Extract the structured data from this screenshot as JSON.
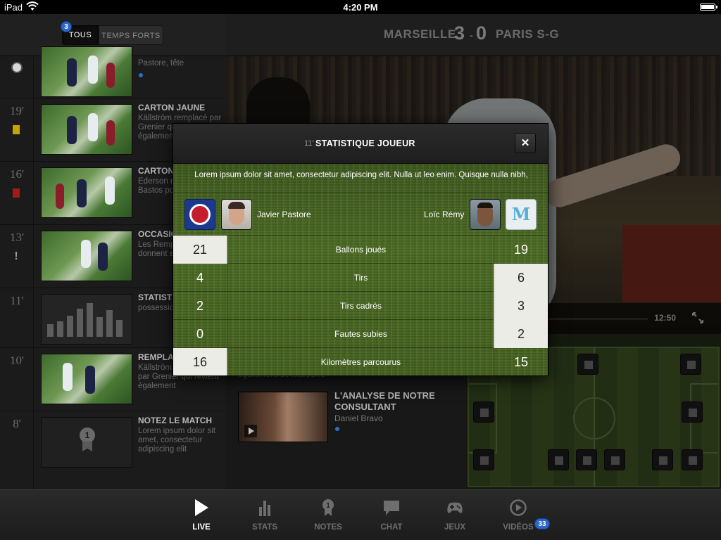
{
  "status_bar": {
    "device": "iPad",
    "time": "4:20 PM"
  },
  "filter": {
    "all_label": "TOUS",
    "highlights_label": "TEMPS FORTS",
    "all_count": "3"
  },
  "timeline": [
    {
      "minute": "",
      "title": "",
      "desc": "Pastore, tête",
      "event": "goal"
    },
    {
      "minute": "19'",
      "title": "CARTON JAUNE",
      "desc": "Källström remplacé par Grenier qui revient également",
      "event": "yellow-card"
    },
    {
      "minute": "16'",
      "title": "CARTON ROUGE",
      "desc": "Ederson remplacé par Bastos pour",
      "event": "red-card"
    },
    {
      "minute": "13'",
      "title": "OCCASION",
      "desc": "Les Remplaçants donnent sur acte.",
      "event": "chance"
    },
    {
      "minute": "11'",
      "title": "STATISTIQUE",
      "desc": "possession de Javier",
      "event": "stats"
    },
    {
      "minute": "10'",
      "title": "REMPLACEMENT",
      "desc": "Källström est remplacé par Grenier qui revient également",
      "event": "substitution"
    },
    {
      "minute": "8'",
      "title": "NOTEZ LE MATCH",
      "desc": "Lorem ipsum dolor sit amet, consectetur adipiscing elit",
      "event": "rating",
      "medal": "1"
    }
  ],
  "scoreboard": {
    "home_team": "MARSEILLE",
    "home_score": "3",
    "separator": "-",
    "away_score": "0",
    "away_team": "PARIS S-G"
  },
  "video": {
    "time": "12:50"
  },
  "analysis": {
    "partial_text": "également de Marseille",
    "title": "L'ANALYSE DE NOTRE CONSULTANT",
    "author": "Daniel Bravo"
  },
  "modal": {
    "minute": "11'",
    "title": "STATISTIQUE JOUEUR",
    "close_label": "✕",
    "intro": "Lorem ipsum dolor sit amet, consectetur adipiscing elit. Nulla ut leo enim. Quisque nulla nibh,",
    "home_player": "Javier Pastore",
    "away_player": "Loïc Rémy",
    "away_crest_letter": "M",
    "stats": [
      {
        "label": "Ballons joués",
        "home": "21",
        "away": "19",
        "winner": "home"
      },
      {
        "label": "Tirs",
        "home": "4",
        "away": "6",
        "winner": "away"
      },
      {
        "label": "Tirs cadrés",
        "home": "2",
        "away": "3",
        "winner": "away"
      },
      {
        "label": "Fautes subies",
        "home": "0",
        "away": "2",
        "winner": "away"
      },
      {
        "label": "Kilomètres parcourus",
        "home": "16",
        "away": "15",
        "winner": "home"
      }
    ]
  },
  "tabs": [
    {
      "label": "LIVE",
      "icon": "play-icon",
      "active": true
    },
    {
      "label": "STATS",
      "icon": "stats-icon"
    },
    {
      "label": "NOTES",
      "icon": "medal-icon"
    },
    {
      "label": "CHAT",
      "icon": "chat-icon"
    },
    {
      "label": "JEUX",
      "icon": "gamepad-icon"
    },
    {
      "label": "VIDÉOS",
      "icon": "video-play-icon",
      "badge": "33"
    }
  ],
  "colors": {
    "accent_blue": "#2b66c8",
    "grass": "#4d6c24",
    "yellow_card": "#c9a100",
    "red_card": "#a11c14"
  }
}
